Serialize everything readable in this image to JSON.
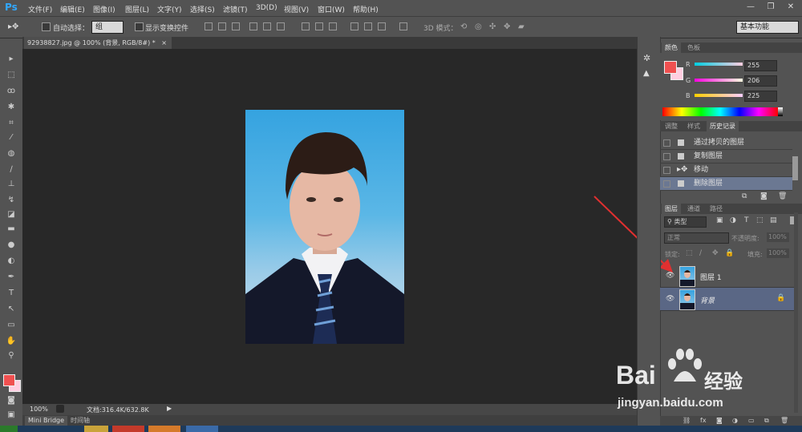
{
  "app": {
    "logo": "Ps"
  },
  "menu": [
    "文件(F)",
    "编辑(E)",
    "图像(I)",
    "图层(L)",
    "文字(Y)",
    "选择(S)",
    "滤镜(T)",
    "3D(D)",
    "视图(V)",
    "窗口(W)",
    "帮助(H)"
  ],
  "window_controls": {
    "minimize": "—",
    "restore": "❐",
    "close": "✕"
  },
  "options": {
    "auto_select_label": "自动选择：",
    "auto_select_value": "组",
    "show_transform_label": "显示变换控件",
    "mode3d_label": "3D 模式：",
    "workspace": "基本功能"
  },
  "document": {
    "tab_title": "92938827.jpg @ 100% (背景, RGB/8#) *"
  },
  "status": {
    "zoom": "100%",
    "doc_info": "文档:316.4K/632.8K"
  },
  "bottom_tabs": [
    "Mini Bridge",
    "时间轴"
  ],
  "color_panel": {
    "tabs": [
      "颜色",
      "色板"
    ],
    "channels": [
      {
        "label": "R",
        "value": "255"
      },
      {
        "label": "G",
        "value": "206"
      },
      {
        "label": "B",
        "value": "225"
      }
    ],
    "fg_color": "#f05050",
    "bg_color": "#ffcee1"
  },
  "history_panel": {
    "tabs": [
      "调整",
      "样式",
      "历史记录"
    ],
    "items": [
      "通过拷贝的图层",
      "复制图层",
      "移动",
      "删除图层"
    ]
  },
  "layers_panel": {
    "tabs": [
      "图层",
      "通道",
      "路径"
    ],
    "filter_label": "类型",
    "blend_mode": "正常",
    "opacity_label": "不透明度:",
    "opacity_value": "100%",
    "lock_label": "锁定:",
    "fill_label": "填充:",
    "fill_value": "100%",
    "layers": [
      {
        "name": "图层 1"
      },
      {
        "name": "背景"
      }
    ]
  },
  "watermark": {
    "brand": "Bai",
    "brand2": "经验",
    "url": "jingyan.baidu.com"
  }
}
